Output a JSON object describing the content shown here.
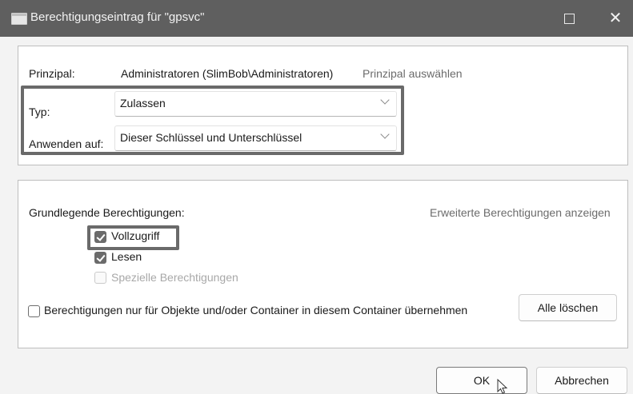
{
  "window": {
    "title": "Berechtigungseintrag für \"gpsvc\"",
    "maximize_icon": "maximize-icon",
    "close_glyph": "✕"
  },
  "principal": {
    "label": "Prinzipal:",
    "value": "Administratoren (SlimBob\\Administratoren)",
    "select_link": "Prinzipal auswählen"
  },
  "type": {
    "label": "Typ:",
    "value": "Zulassen"
  },
  "apply_to": {
    "label": "Anwenden auf:",
    "value": "Dieser Schlüssel und Unterschlüssel"
  },
  "permissions": {
    "heading": "Grundlegende Berechtigungen:",
    "advanced_link": "Erweiterte Berechtigungen anzeigen",
    "items": [
      {
        "label": "Vollzugriff",
        "checked": true,
        "enabled": true
      },
      {
        "label": "Lesen",
        "checked": true,
        "enabled": true
      },
      {
        "label": "Spezielle Berechtigungen",
        "checked": false,
        "enabled": false
      }
    ],
    "inherit_label": "Berechtigungen nur für Objekte und/oder Container in diesem Container übernehmen",
    "inherit_checked": false,
    "clear_all_label": "Alle löschen"
  },
  "footer": {
    "ok_label": "OK",
    "cancel_label": "Abbrechen"
  },
  "colors": {
    "titlebar": "#5f5f5f",
    "highlight_border": "#6a6a6a",
    "checkbox_fill": "#6b6b6b"
  }
}
